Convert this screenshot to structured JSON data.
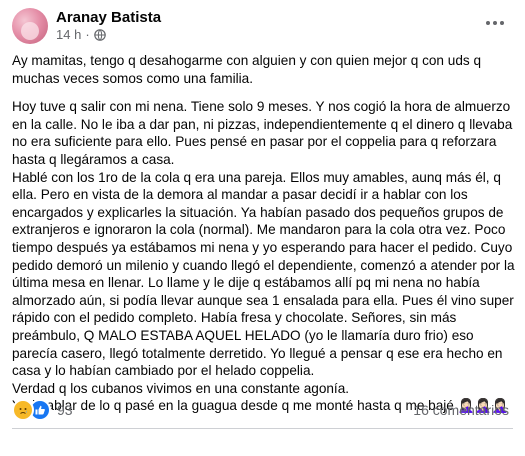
{
  "post": {
    "author": "Aranay Batista",
    "time": "14 h",
    "separator": "·",
    "paragraphs_block1": [
      "Ay mamitas, tengo q desahogarme con alguien y con quien mejor q con uds q muchas veces somos como una familia."
    ],
    "paragraphs_block2": [
      "Hoy tuve q salir con mi nena. Tiene solo 9 meses. Y nos cogió la hora de almuerzo en la calle. No le iba a dar pan, ni pizzas, independientemente q el dinero q llevaba no era suficiente para ello. Pues pensé en pasar por el coppelia para q reforzara hasta q llegáramos a casa.",
      "Hablé con los 1ro de la cola q era una pareja. Ellos muy amables, aunq más él, q ella. Pero en vista de la demora al mandar a pasar decidí ir a hablar con los encargados y explicarles la situación. Ya habían pasado dos pequeños grupos de extranjeros e ignoraron la cola (normal). Me mandaron para la cola otra vez. Poco tiempo después ya estábamos mi nena y yo esperando para hacer el pedido. Cuyo pedido demoró un milenio y cuando llegó el dependiente, comenzó a atender por la última mesa en llenar. Lo llame y le dije q estábamos allí pq mi nena no había almorzado aún, si podía llevar aunque sea 1 ensalada para ella. Pues él vino super rápido con el pedido completo. Había fresa y chocolate. Señores, sin más preámbulo, Q MALO ESTABA AQUEL HELADO (yo le llamaría duro frio) eso parecía casero, llegó totalmente derretido. Yo llegué a pensar q ese era hecho en casa y lo habían cambiado por el helado coppelia.",
      "Verdad q los cubanos vivimos en una constante agonía.",
      "Y ni hablar de lo q pasé en la guagua desde q me monté hasta q me bajé 🤦🏻‍♀️🤦🏻‍♀️🤦🏻‍♀️"
    ]
  },
  "footer": {
    "reaction_count": "93",
    "comments": "16 comentarios"
  },
  "icons": {
    "reactions": [
      "sad-icon",
      "like-icon"
    ],
    "privacy": "globe-icon",
    "menu": "more-options-icon"
  },
  "colors": {
    "text": "#050505",
    "secondary": "#65676b",
    "like_blue": "#1877f2",
    "sad_yellow": "#f7b928"
  }
}
